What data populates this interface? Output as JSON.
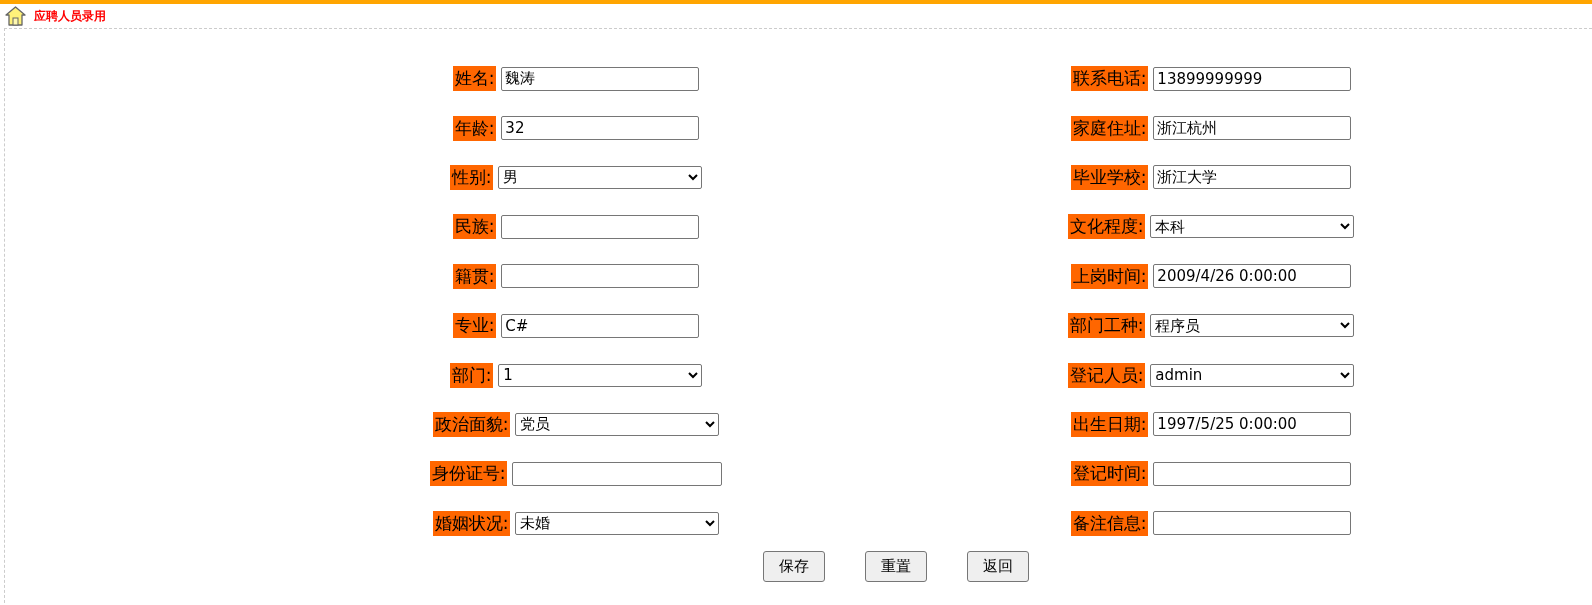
{
  "page_title": "应聘人员录用",
  "left_fields": [
    {
      "label": "姓名:",
      "kind": "text",
      "value": "魏涛"
    },
    {
      "label": "年龄:",
      "kind": "text",
      "value": "32"
    },
    {
      "label": "性别:",
      "kind": "select",
      "value": "男"
    },
    {
      "label": "民族:",
      "kind": "text"
    },
    {
      "label": "籍贯:",
      "kind": "text"
    },
    {
      "label": "专业:",
      "kind": "text",
      "value": "C#"
    },
    {
      "label": "部门:",
      "kind": "select",
      "value": "1"
    },
    {
      "label": "政治面貌:",
      "kind": "select",
      "value": "党员"
    },
    {
      "label": "身份证号:",
      "kind": "wide_text"
    },
    {
      "label": "婚姻状况:",
      "kind": "select",
      "value": "未婚"
    }
  ],
  "right_fields": [
    {
      "label": "联系电话:",
      "kind": "text",
      "value": "13899999999"
    },
    {
      "label": "家庭住址:",
      "kind": "text",
      "value": "浙江杭州"
    },
    {
      "label": "毕业学校:",
      "kind": "text",
      "value": "浙江大学"
    },
    {
      "label": "文化程度:",
      "kind": "select",
      "value": "本科"
    },
    {
      "label": "上岗时间:",
      "kind": "text",
      "value": "2009/4/26 0:00:00"
    },
    {
      "label": "部门工种:",
      "kind": "select",
      "value": "程序员"
    },
    {
      "label": "登记人员:",
      "kind": "select",
      "value": "admin"
    },
    {
      "label": "出生日期:",
      "kind": "text",
      "value": "1997/5/25 0:00:00"
    },
    {
      "label": "登记时间:",
      "kind": "text"
    },
    {
      "label": "备注信息:",
      "kind": "text"
    }
  ],
  "buttons": [
    "保存",
    "重置",
    "返回"
  ]
}
